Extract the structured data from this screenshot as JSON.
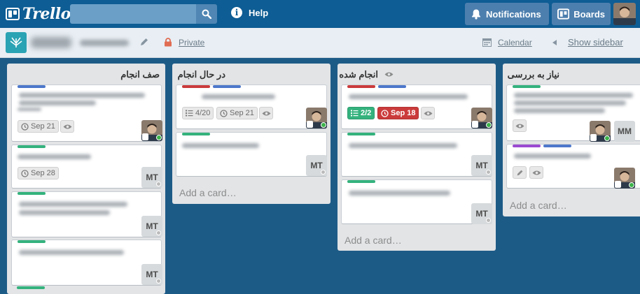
{
  "header": {
    "logo_text": "Trello",
    "search": {
      "placeholder": "",
      "value": ""
    },
    "help_label": "Help",
    "notifications_label": "Notifications",
    "boards_label": "Boards"
  },
  "board": {
    "visibility": "Private",
    "calendar_label": "Calendar",
    "show_sidebar_label": "Show sidebar"
  },
  "lists": [
    {
      "title": "صف انجام",
      "cards": [
        {
          "due": "Sep 21"
        },
        {
          "due": "Sep 28",
          "member": "MT"
        },
        {
          "member": "MT"
        },
        {
          "member": "MT"
        }
      ]
    },
    {
      "title": "در حال انجام",
      "cards": [
        {
          "checklist": "4/20",
          "due": "Sep 21"
        },
        {
          "member": "MT"
        }
      ],
      "add_card": "Add a card…"
    },
    {
      "title": "انجام شده",
      "cards": [
        {
          "checklist": "2/2",
          "due": "Sep 18"
        },
        {
          "member": "MT"
        },
        {
          "member": "MT"
        }
      ],
      "add_card": "Add a card…"
    },
    {
      "title": "نیاز به بررسی",
      "cards": [
        {
          "member": "MM"
        },
        {}
      ],
      "add_card": "Add a card…"
    }
  ],
  "colors": {
    "label_blue": "#4d77cb",
    "label_green": "#34b27d",
    "label_red": "#cb3b3b",
    "label_purple": "#9b4ad1",
    "board_background": "#1d5b87"
  },
  "icons": [
    "trello-logo-icon",
    "search-icon",
    "info-icon",
    "bell-icon",
    "boards-icon",
    "pencil-icon",
    "lock-icon",
    "calendar-icon",
    "clock-icon",
    "eye-icon",
    "checklist-icon"
  ]
}
